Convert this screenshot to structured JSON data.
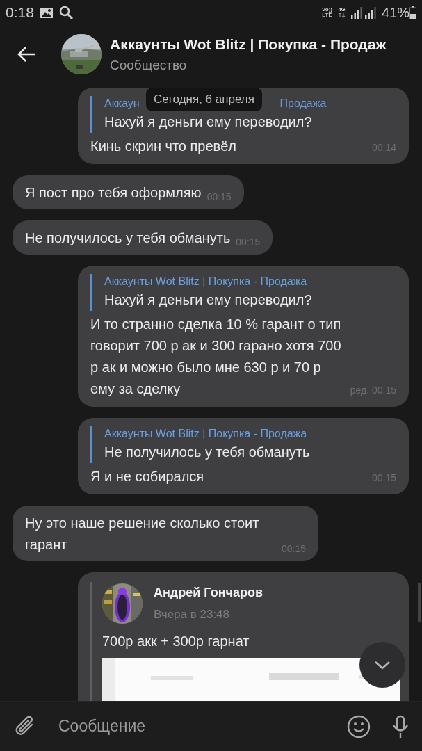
{
  "status_bar": {
    "time": "0:18",
    "volte_top": "Vo))",
    "volte_bottom": "LTE",
    "network": "4G",
    "battery": "41%"
  },
  "header": {
    "title": "Аккаунты Wot Blitz | Покупка - Продаж",
    "subtitle": "Сообщество"
  },
  "date_pill": "Сегодня, 6 апреля",
  "messages": [
    {
      "kind": "out",
      "reply": {
        "author_fragments": [
          "Аккаун",
          "Продажа"
        ],
        "text": "Нахуй я деньги ему переводил?"
      },
      "text": "Кинь скрин что превёл",
      "time": "00:14"
    },
    {
      "kind": "in",
      "text": "Я пост про тебя оформляю",
      "time": "00:15"
    },
    {
      "kind": "in",
      "text": "Не получилось у тебя обмануть",
      "time": "00:15"
    },
    {
      "kind": "out",
      "reply": {
        "author_fragments": [
          "Аккаунты Wot Blitz | Покупка - Продажа"
        ],
        "text": "Нахуй я деньги ему переводил?"
      },
      "text": "И то странно сделка 10 % гарант о тип говорит 700 р ак и 300 гарано хотя 700 р ак и можно было мне 630 р и 70 р ему за сделку",
      "time": "ред. 00:15"
    },
    {
      "kind": "out",
      "reply": {
        "author_fragments": [
          "Аккаунты Wot Blitz | Покупка - Продажа"
        ],
        "text": "Не получилось у тебя обмануть"
      },
      "text": "Я и не собирался",
      "time": "00:15"
    },
    {
      "kind": "in",
      "text": "Ну это наше решение сколько стоит гарант",
      "time": "00:15"
    },
    {
      "kind": "forward",
      "author": "Андрей Гончаров",
      "date": "Вчера в 23:48",
      "text": "700р акк + 300р гарнат"
    }
  ],
  "composer": {
    "placeholder": "Сообщение"
  }
}
